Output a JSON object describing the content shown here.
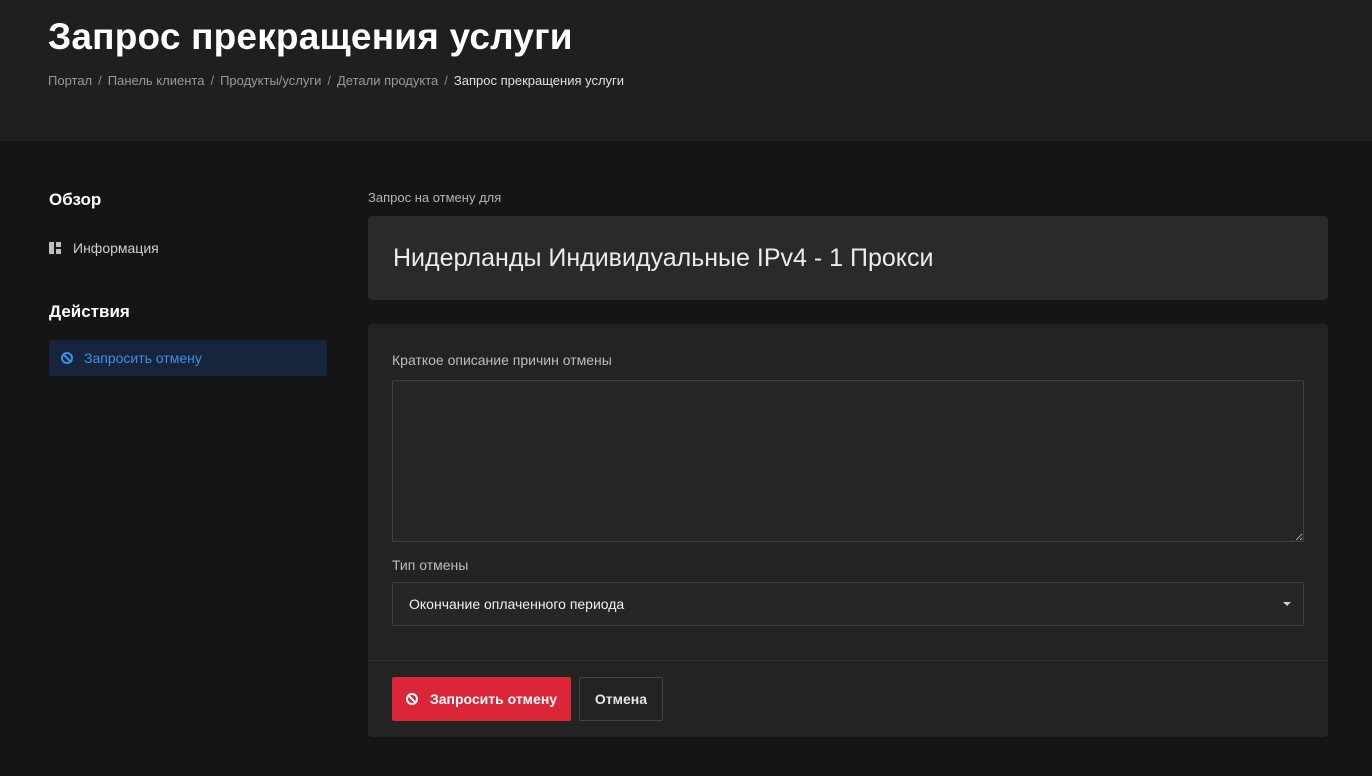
{
  "header": {
    "title": "Запрос прекращения услуги",
    "breadcrumb": [
      "Портал",
      "Панель клиента",
      "Продукты/услуги",
      "Детали продукта",
      "Запрос прекращения услуги"
    ],
    "breadcrumb_separator": "/"
  },
  "sidebar": {
    "overview_title": "Обзор",
    "info_item": {
      "label": "Информация",
      "icon": "dashboard-icon"
    },
    "actions_title": "Действия",
    "active_item": {
      "label": "Запросить отмену",
      "icon": "ban-icon"
    }
  },
  "main": {
    "cancel_for_label": "Запрос на отмену для",
    "product_name": "Нидерланды Индивидуальные IPv4 - 1 Прокси",
    "reason_label": "Краткое описание причин отмены",
    "reason_value": "",
    "type_label": "Тип отмены",
    "type_selected": "Окончание оплаченного периода",
    "submit_label": "Запросить отмену",
    "cancel_label": "Отмена"
  },
  "colors": {
    "accent_blue": "#3f8fe8",
    "danger_red": "#dc2638",
    "background": "#151515",
    "header_bg": "#1f1f1f"
  }
}
